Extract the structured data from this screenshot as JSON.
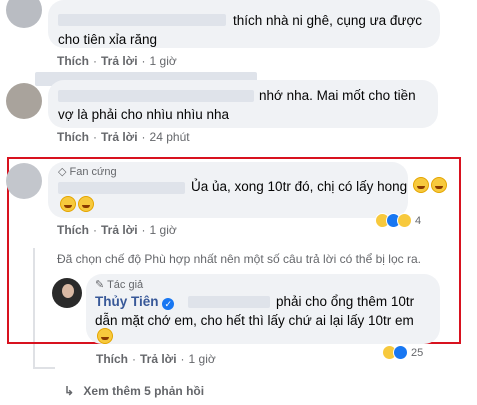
{
  "comments": [
    {
      "text": "thích nhà ni ghê, cụng ưa được",
      "text2": "cho tiên xỉa răng",
      "like": "Thích",
      "reply": "Trả lời",
      "time": "1 giờ"
    },
    {
      "text": "nhớ nha. Mai mốt cho tiền",
      "text2": "vợ là phải cho nhìu nhìu nha",
      "like": "Thích",
      "reply": "Trả lời",
      "time": "24 phút"
    },
    {
      "badge": "Fan cứng",
      "text": "Ủa ủa, xong 10tr đó, chị có lấy hong",
      "like": "Thích",
      "reply": "Trả lời",
      "time": "1 giờ",
      "reaction_count": "4"
    }
  ],
  "filter_notice": "Đã chọn chế độ Phù hợp nhất nên một số câu trả lời có thể bị lọc ra.",
  "reply": {
    "badge": "Tác giả",
    "author": "Thủy Tiên",
    "text": "phải cho ổng thêm 10tr",
    "text2": "dẫn mặt chớ em, cho hết thì lấy chứ ai lại lấy 10tr em",
    "like": "Thích",
    "reply": "Trả lời",
    "time": "1 giờ",
    "reaction_count": "25"
  },
  "more_replies": "Xem thêm 5 phản hồi",
  "colors": {
    "highlight_box": "#d8121f",
    "verified": "#1877f2",
    "bubble": "#f0f2f5"
  }
}
